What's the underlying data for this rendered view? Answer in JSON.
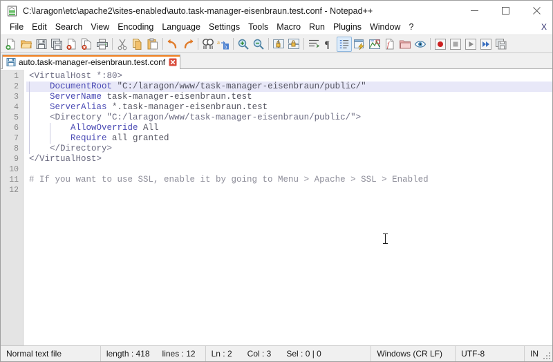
{
  "window": {
    "title": "C:\\laragon\\etc\\apache2\\sites-enabled\\auto.task-manager-eisenbraun.test.conf - Notepad++",
    "app_icon": "notepad-plus-plus-icon",
    "controls": {
      "minimize": "minimize-icon",
      "maximize": "maximize-icon",
      "close": "close-icon"
    }
  },
  "menubar": {
    "items": [
      {
        "label": "File"
      },
      {
        "label": "Edit"
      },
      {
        "label": "Search"
      },
      {
        "label": "View"
      },
      {
        "label": "Encoding"
      },
      {
        "label": "Language"
      },
      {
        "label": "Settings"
      },
      {
        "label": "Tools"
      },
      {
        "label": "Macro"
      },
      {
        "label": "Run"
      },
      {
        "label": "Plugins"
      },
      {
        "label": "Window"
      },
      {
        "label": "?"
      }
    ],
    "close_document_label": "X"
  },
  "toolbar": {
    "buttons": [
      {
        "name": "new-file-icon",
        "title": "New"
      },
      {
        "name": "open-file-icon",
        "title": "Open"
      },
      {
        "name": "save-icon",
        "title": "Save"
      },
      {
        "name": "save-all-icon",
        "title": "Save All"
      },
      {
        "name": "close-file-icon",
        "title": "Close"
      },
      {
        "name": "close-all-files-icon",
        "title": "Close All"
      },
      {
        "name": "print-icon",
        "title": "Print"
      },
      {
        "name": "cut-icon",
        "title": "Cut"
      },
      {
        "name": "copy-icon",
        "title": "Copy"
      },
      {
        "name": "paste-icon",
        "title": "Paste"
      },
      {
        "name": "undo-icon",
        "title": "Undo"
      },
      {
        "name": "redo-icon",
        "title": "Redo"
      },
      {
        "name": "find-icon",
        "title": "Find"
      },
      {
        "name": "replace-icon",
        "title": "Replace"
      },
      {
        "name": "zoom-in-icon",
        "title": "Zoom In"
      },
      {
        "name": "zoom-out-icon",
        "title": "Zoom Out"
      },
      {
        "name": "sync-vertical-scroll-icon",
        "title": "Synchronize Vertical Scrolling"
      },
      {
        "name": "sync-horizontal-scroll-icon",
        "title": "Synchronize Horizontal Scrolling"
      },
      {
        "name": "word-wrap-icon",
        "title": "Word Wrap"
      },
      {
        "name": "show-all-characters-icon",
        "title": "Show All Characters"
      },
      {
        "name": "indent-guide-icon",
        "title": "Show Indent Guide"
      },
      {
        "name": "ui-dialog-icon",
        "title": "User Defined Dialogue"
      },
      {
        "name": "document-map-icon",
        "title": "Document Map"
      },
      {
        "name": "function-list-icon",
        "title": "Function List"
      },
      {
        "name": "folder-as-workspace-icon",
        "title": "Folder as Workspace"
      },
      {
        "name": "monitoring-icon",
        "title": "Monitoring"
      },
      {
        "name": "macro-record-icon",
        "title": "Start Recording"
      },
      {
        "name": "macro-stop-icon",
        "title": "Stop Recording"
      },
      {
        "name": "macro-play-icon",
        "title": "Playback"
      },
      {
        "name": "macro-run-multiple-icon",
        "title": "Run a Macro Multiple Times"
      },
      {
        "name": "macro-save-icon",
        "title": "Save Current Recorded Macro"
      }
    ]
  },
  "tabs": [
    {
      "label": "auto.task-manager-eisenbraun.test.conf",
      "icon": "saved-file-icon",
      "close_icon": "tab-close-icon",
      "active": true
    }
  ],
  "editor": {
    "line_numbers": [
      "1",
      "2",
      "3",
      "4",
      "5",
      "6",
      "7",
      "8",
      "9",
      "10",
      "11",
      "12"
    ],
    "current_line": 2,
    "lines": [
      {
        "n": 1,
        "text": "<VirtualHost *:80>"
      },
      {
        "n": 2,
        "text": "    DocumentRoot \"C:/laragon/www/task-manager-eisenbraun/public/\""
      },
      {
        "n": 3,
        "text": "    ServerName task-manager-eisenbraun.test"
      },
      {
        "n": 4,
        "text": "    ServerAlias *.task-manager-eisenbraun.test"
      },
      {
        "n": 5,
        "text": "    <Directory \"C:/laragon/www/task-manager-eisenbraun/public/\">"
      },
      {
        "n": 6,
        "text": "        AllowOverride All"
      },
      {
        "n": 7,
        "text": "        Require all granted"
      },
      {
        "n": 8,
        "text": "    </Directory>"
      },
      {
        "n": 9,
        "text": "</VirtualHost>"
      },
      {
        "n": 10,
        "text": ""
      },
      {
        "n": 11,
        "text": "# If you want to use SSL, enable it by going to Menu > Apache > SSL > Enabled"
      },
      {
        "n": 12,
        "text": ""
      }
    ],
    "segments": [
      {
        "n": 1,
        "parts": [
          {
            "t": "<VirtualHost *:80>",
            "c": "tok-tag"
          }
        ]
      },
      {
        "n": 2,
        "parts": [
          {
            "t": "    ",
            "c": "tok-val"
          },
          {
            "t": "DocumentRoot",
            "c": "tok-attr"
          },
          {
            "t": " \"C:/laragon/www/task-manager-eisenbraun/public/\"",
            "c": "tok-str"
          }
        ]
      },
      {
        "n": 3,
        "parts": [
          {
            "t": "    ",
            "c": "tok-val"
          },
          {
            "t": "ServerName",
            "c": "tok-attr"
          },
          {
            "t": " task-manager-eisenbraun.test",
            "c": "tok-str"
          }
        ]
      },
      {
        "n": 4,
        "parts": [
          {
            "t": "    ",
            "c": "tok-val"
          },
          {
            "t": "ServerAlias",
            "c": "tok-attr"
          },
          {
            "t": " *.task-manager-eisenbraun.test",
            "c": "tok-str"
          }
        ]
      },
      {
        "n": 5,
        "parts": [
          {
            "t": "    ",
            "c": "tok-val"
          },
          {
            "t": "<Directory \"C:/laragon/www/task-manager-eisenbraun/public/\">",
            "c": "tok-tag"
          }
        ]
      },
      {
        "n": 6,
        "parts": [
          {
            "t": "        ",
            "c": "tok-val"
          },
          {
            "t": "AllowOverride",
            "c": "tok-attr"
          },
          {
            "t": " All",
            "c": "tok-str"
          }
        ]
      },
      {
        "n": 7,
        "parts": [
          {
            "t": "        ",
            "c": "tok-val"
          },
          {
            "t": "Require",
            "c": "tok-attr"
          },
          {
            "t": " all granted",
            "c": "tok-str"
          }
        ]
      },
      {
        "n": 8,
        "parts": [
          {
            "t": "    ",
            "c": "tok-val"
          },
          {
            "t": "</Directory>",
            "c": "tok-tag"
          }
        ]
      },
      {
        "n": 9,
        "parts": [
          {
            "t": "</VirtualHost>",
            "c": "tok-tag"
          }
        ]
      },
      {
        "n": 10,
        "parts": []
      },
      {
        "n": 11,
        "parts": [
          {
            "t": "# If you want to use SSL, enable it by going to Menu > Apache > SSL > Enabled",
            "c": "tok-comment"
          }
        ]
      },
      {
        "n": 12,
        "parts": []
      }
    ],
    "mouse_cursor": "text-ibeam-cursor"
  },
  "statusbar": {
    "file_type": "Normal text file",
    "length": "length : 418",
    "lines": "lines : 12",
    "ln": "Ln : 2",
    "col": "Col : 3",
    "sel": "Sel : 0 | 0",
    "eol": "Windows (CR LF)",
    "encoding": "UTF-8",
    "insert_mode": "IN"
  },
  "colors": {
    "accent_orange": "#f58220",
    "toolbar_bg": "#f0f0f0",
    "gutter_bg": "#e4e4e4",
    "current_line_bg": "#e8e8f8",
    "keyword_blue": "#4a4ab4",
    "tag_gray": "#6a6a80",
    "comment_gray": "#8d8d99"
  }
}
